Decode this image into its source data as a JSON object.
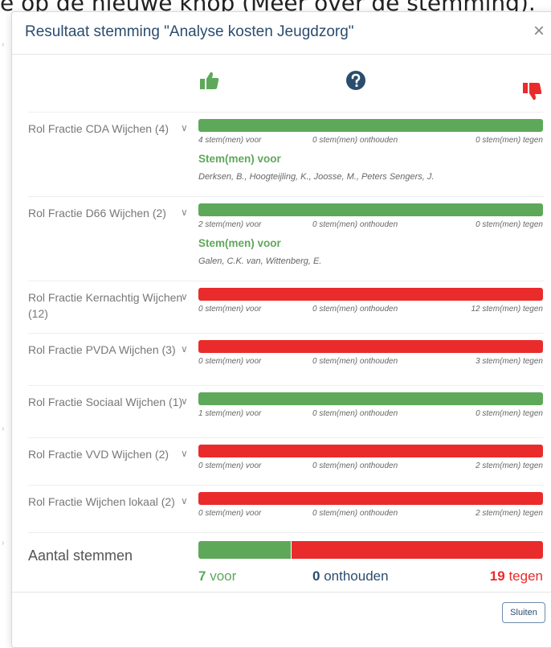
{
  "background": {
    "partial_text": "e op de nieuwe knop (Meer over de stemming)."
  },
  "modal": {
    "title": "Resultaat stemming \"Analyse kosten Jeugdzorg\"",
    "close_glyph": "×"
  },
  "legend_icons": [
    "thumbs-up-icon",
    "question-circle-icon",
    "thumbs-down-icon"
  ],
  "colors": {
    "voor": "#5ea85a",
    "onthouden": "#2a4d6e",
    "tegen": "#ea2b2b"
  },
  "factions": [
    {
      "label": "Rol Fractie CDA Wijchen (4)",
      "result": "voor",
      "expanded": true,
      "voor": "4 stem(men) voor",
      "onthouden": "0 stem(men) onthouden",
      "tegen": "0 stem(men) tegen",
      "vote_title": "Stem(men) voor",
      "names": "Derksen, B., Hoogteijling, K., Joosse, M., Peters Sengers, J."
    },
    {
      "label": "Rol Fractie D66 Wijchen (2)",
      "result": "voor",
      "expanded": true,
      "voor": "2 stem(men) voor",
      "onthouden": "0 stem(men) onthouden",
      "tegen": "0 stem(men) tegen",
      "vote_title": "Stem(men) voor",
      "names": "Galen, C.K. van, Wittenberg, E."
    },
    {
      "label": "Rol Fractie Kernachtig Wijchen (12)",
      "result": "tegen",
      "expanded": false,
      "voor": "0 stem(men) voor",
      "onthouden": "0 stem(men) onthouden",
      "tegen": "12 stem(men) tegen"
    },
    {
      "label": "Rol Fractie PVDA Wijchen (3)",
      "result": "tegen",
      "expanded": false,
      "voor": "0 stem(men) voor",
      "onthouden": "0 stem(men) onthouden",
      "tegen": "3 stem(men) tegen"
    },
    {
      "label": "Rol Fractie Sociaal Wijchen (1)",
      "result": "voor",
      "expanded": false,
      "voor": "1 stem(men) voor",
      "onthouden": "0 stem(men) onthouden",
      "tegen": "0 stem(men) tegen"
    },
    {
      "label": "Rol Fractie VVD Wijchen (2)",
      "result": "tegen",
      "expanded": false,
      "voor": "0 stem(men) voor",
      "onthouden": "0 stem(men) onthouden",
      "tegen": "2 stem(men) tegen"
    },
    {
      "label": "Rol Fractie Wijchen lokaal (2)",
      "result": "tegen",
      "expanded": false,
      "voor": "0 stem(men) voor",
      "onthouden": "0 stem(men) onthouden",
      "tegen": "2 stem(men) tegen"
    }
  ],
  "totals": {
    "label": "Aantal stemmen",
    "voor_count": "7",
    "voor_word": "voor",
    "onthouden_count": "0",
    "onthouden_word": "onthouden",
    "tegen_count": "19",
    "tegen_word": "tegen",
    "voor_fraction": 0.269
  },
  "footer": {
    "close_button": "Sluiten"
  }
}
